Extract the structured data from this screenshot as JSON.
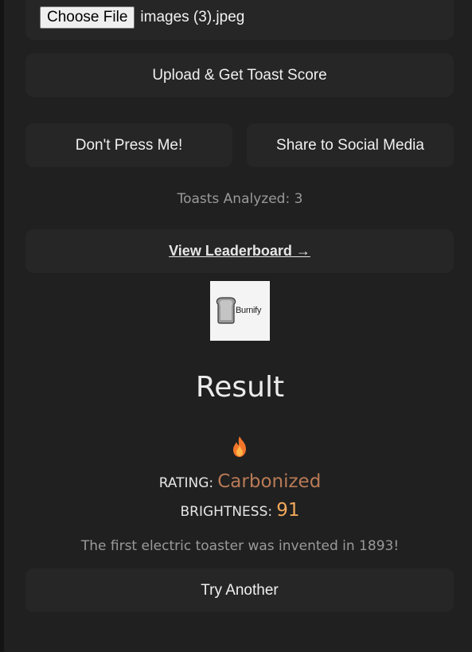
{
  "upload": {
    "choose_file_label": "Choose File",
    "file_name": "images (3).jpeg",
    "upload_button": "Upload & Get Toast Score"
  },
  "actions": {
    "dont_press": "Don't Press Me!",
    "share": "Share to Social Media"
  },
  "stats": {
    "toasts_analyzed": "Toasts Analyzed: 3"
  },
  "leaderboard": {
    "link": "View Leaderboard →"
  },
  "logo": {
    "text": "Burnify"
  },
  "result": {
    "title": "Result",
    "icon": "fire-icon",
    "rating_label": "RATING:",
    "rating_value": "Carbonized",
    "brightness_label": "BRIGHTNESS:",
    "brightness_value": "91",
    "fact": "The first electric toaster was invented in 1893!",
    "try_another": "Try Another"
  },
  "colors": {
    "background": "#202020",
    "panel": "#262626",
    "rating_accent": "#b97a56",
    "brightness_accent": "#f2a85a"
  }
}
